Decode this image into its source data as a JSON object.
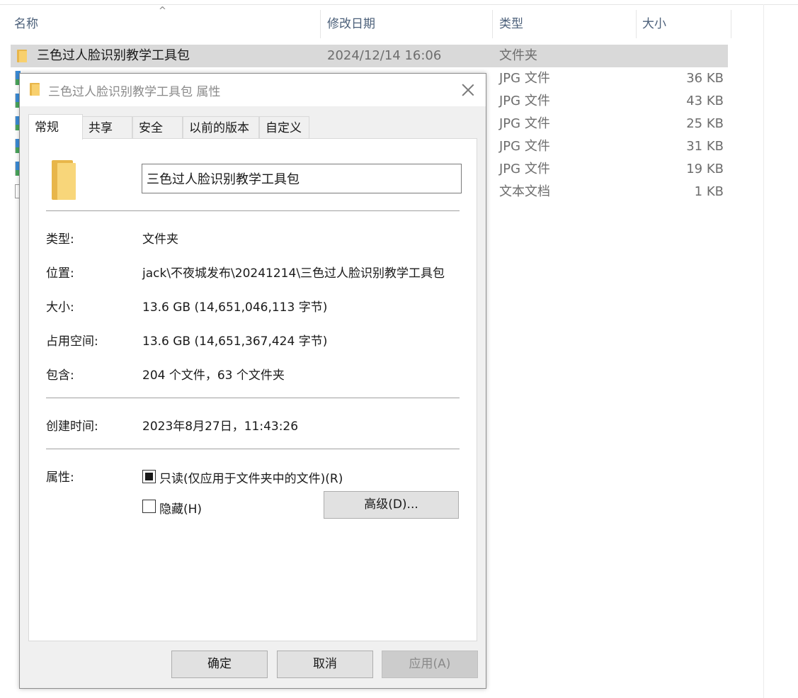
{
  "columns": {
    "name": "名称",
    "modified": "修改日期",
    "type": "类型",
    "size": "大小"
  },
  "files": [
    {
      "name": "三色过人脸识别教学工具包",
      "modified": "2024/12/14 16:06",
      "type": "文件夹",
      "size": ""
    },
    {
      "name": "",
      "modified": "",
      "type": "JPG 文件",
      "size": "36 KB"
    },
    {
      "name": "",
      "modified": "",
      "type": "JPG 文件",
      "size": "43 KB"
    },
    {
      "name": "",
      "modified": "",
      "type": "JPG 文件",
      "size": "25 KB"
    },
    {
      "name": "",
      "modified": "",
      "type": "JPG 文件",
      "size": "31 KB"
    },
    {
      "name": "",
      "modified": "",
      "type": "JPG 文件",
      "size": "19 KB"
    },
    {
      "name": "",
      "modified": "",
      "type": "文本文档",
      "size": "1 KB"
    }
  ],
  "dialog": {
    "title": "三色过人脸识别教学工具包 属性",
    "tabs": [
      "常规",
      "共享",
      "安全",
      "以前的版本",
      "自定义"
    ],
    "folder_name": "三色过人脸识别教学工具包",
    "fields": {
      "type_label": "类型:",
      "type_value": "文件夹",
      "location_label": "位置:",
      "location_value": "jack\\不夜城发布\\20241214\\三色过人脸识别教学工具包",
      "size_label": "大小:",
      "size_value": "13.6 GB (14,651,046,113 字节)",
      "disk_label": "占用空间:",
      "disk_value": "13.6 GB (14,651,367,424 字节)",
      "contains_label": "包含:",
      "contains_value": "204 个文件，63 个文件夹",
      "created_label": "创建时间:",
      "created_value": "2023年8月27日，11:43:26",
      "attributes_label": "属性:"
    },
    "readonly_label": "只读(仅应用于文件夹中的文件)(R)",
    "hidden_label": "隐藏(H)",
    "advanced_button": "高级(D)...",
    "ok_button": "确定",
    "cancel_button": "取消",
    "apply_button": "应用(A)"
  },
  "colors": {
    "selection": "#d9d9d9",
    "folder": "#f8d06e",
    "header_text": "#4c607a"
  }
}
